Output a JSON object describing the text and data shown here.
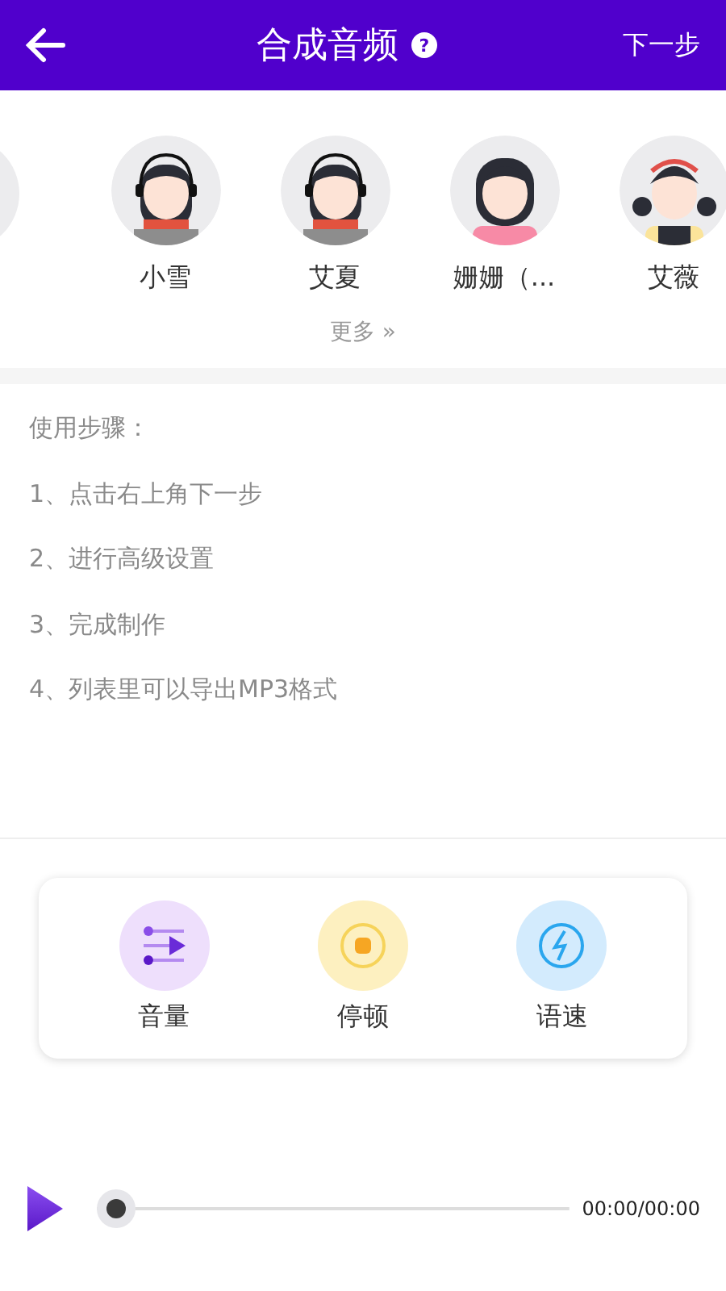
{
  "header": {
    "title": "合成音频",
    "help": "?",
    "next": "下一步"
  },
  "voices": [
    {
      "name": "小雪",
      "kind": "headset"
    },
    {
      "name": "艾夏",
      "kind": "headset"
    },
    {
      "name": "姗姗（...",
      "kind": "longhair"
    },
    {
      "name": "艾薇",
      "kind": "pigtails"
    }
  ],
  "more": "更多 »",
  "steps": {
    "title": "使用步骤：",
    "items": [
      "1、点击右上角下一步",
      "2、进行高级设置",
      "3、完成制作",
      "4、列表里可以导出MP3格式"
    ]
  },
  "tools": [
    {
      "label": "音量",
      "kind": "volume"
    },
    {
      "label": "停顿",
      "kind": "pause"
    },
    {
      "label": "语速",
      "kind": "speed"
    }
  ],
  "player": {
    "time": "00:00/00:00"
  }
}
